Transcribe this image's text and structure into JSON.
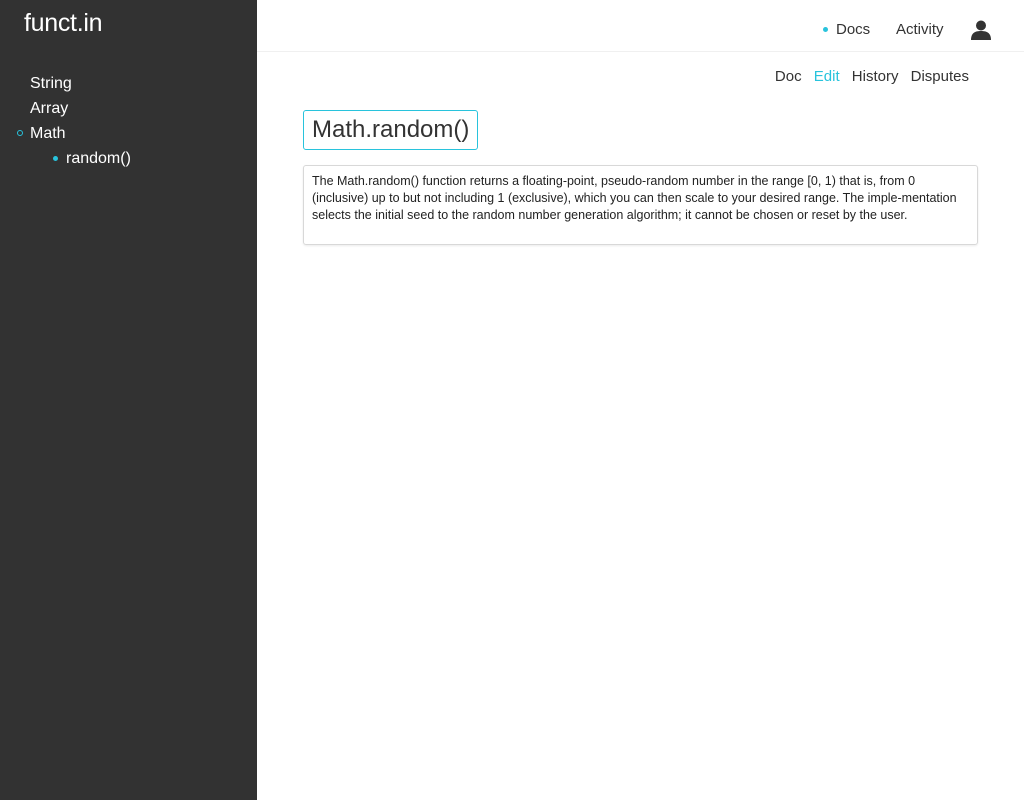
{
  "app": {
    "logo": "funct.in"
  },
  "sidebar": {
    "items": [
      {
        "label": "String"
      },
      {
        "label": "Array"
      },
      {
        "label": "Math",
        "children": [
          {
            "label": "random()"
          }
        ]
      }
    ]
  },
  "topnav": {
    "docs": "Docs",
    "activity": "Activity",
    "user_icon": "user-icon"
  },
  "tabs": {
    "items": [
      "Doc",
      "Edit",
      "History",
      "Disputes"
    ],
    "active": "Edit"
  },
  "doc": {
    "title": "Math.random()",
    "description": "The Math.random() function returns a floating-point, pseudo-random number in the range [0, 1) that is, from 0 (inclusive) up to but not including 1 (exclusive), which you can then scale to your desired range. The imple-mentation selects the initial seed to the random number generation algorithm; it cannot be chosen or reset by the user."
  },
  "colors": {
    "accent": "#28c3dc",
    "sidebar_bg": "#323232"
  }
}
